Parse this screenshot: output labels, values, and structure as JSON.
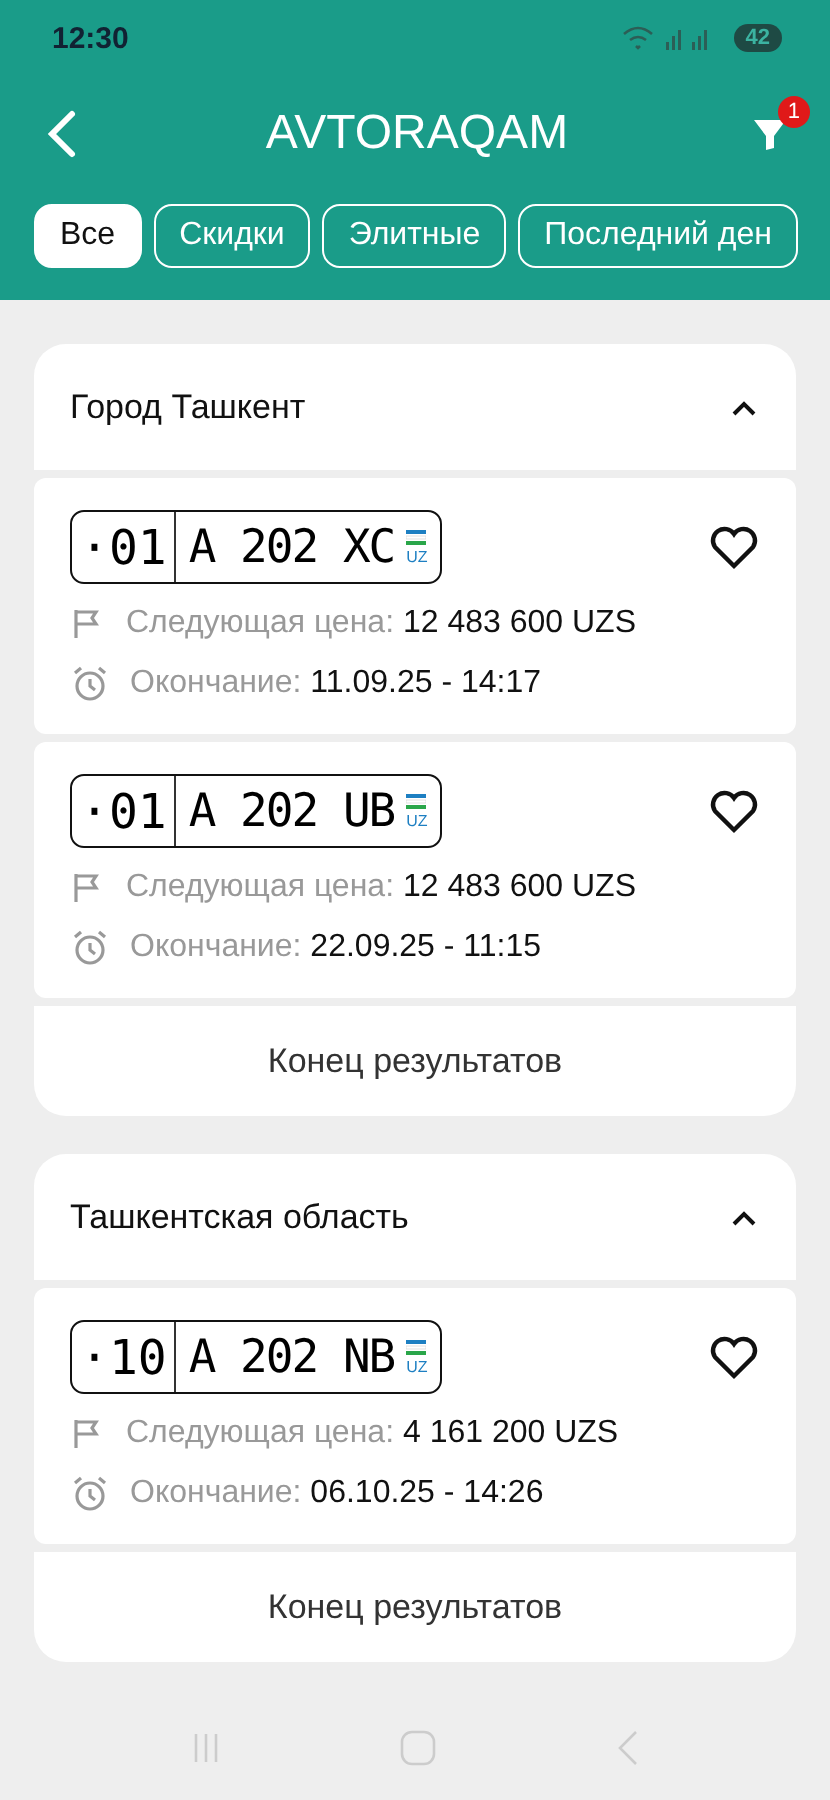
{
  "status_bar": {
    "time": "12:30",
    "battery": "42"
  },
  "header": {
    "title": "AVTORAQAM",
    "filter_badge": "1"
  },
  "tabs": [
    {
      "label": "Все",
      "selected": true
    },
    {
      "label": "Скидки",
      "selected": false
    },
    {
      "label": "Элитные",
      "selected": false
    },
    {
      "label": "Последний ден",
      "selected": false
    }
  ],
  "sections": [
    {
      "title": "Город Ташкент",
      "expanded": true,
      "lots": [
        {
          "region": "·01",
          "number": "A 202 XC",
          "country": "UZ",
          "favorite": false,
          "price_label": "Следующая цена:",
          "price": "12 483 600 UZS",
          "end_label": "Окончание:",
          "end": "11.09.25 - 14:17"
        },
        {
          "region": "·01",
          "number": "A 202 UB",
          "country": "UZ",
          "favorite": false,
          "price_label": "Следующая цена:",
          "price": "12 483 600 UZS",
          "end_label": "Окончание:",
          "end": "22.09.25 - 11:15"
        }
      ],
      "footer": "Конец результатов"
    },
    {
      "title": "Ташкентская область",
      "expanded": true,
      "lots": [
        {
          "region": "·10",
          "number": "A 202 NB",
          "country": "UZ",
          "favorite": false,
          "price_label": "Следующая цена:",
          "price": "4 161 200 UZS",
          "end_label": "Окончание:",
          "end": "06.10.25 - 14:26"
        }
      ],
      "footer": "Конец результатов"
    }
  ]
}
